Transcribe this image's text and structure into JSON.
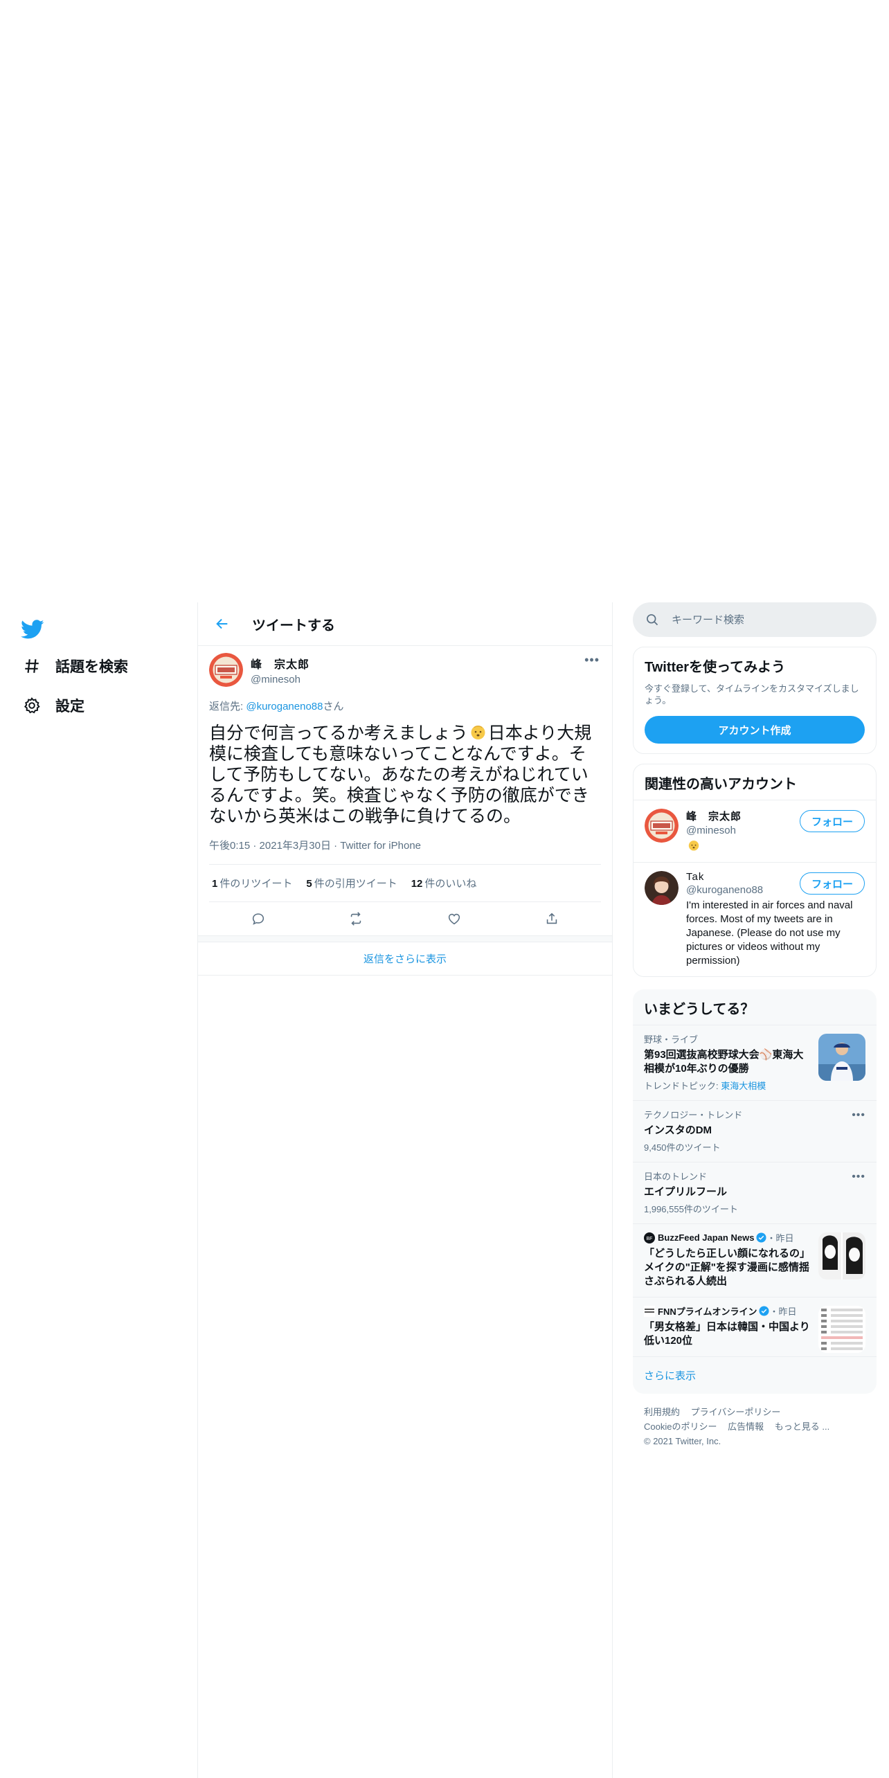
{
  "nav": {
    "explore_label": "話題を検索",
    "settings_label": "設定"
  },
  "header": {
    "title": "ツイートする"
  },
  "tweet": {
    "display_name": "峰　宗太郎",
    "handle": "@minesoh",
    "reply_prefix": "返信先: ",
    "reply_handle": "@kuroganeno88",
    "reply_suffix": "さん",
    "text_part1": "自分で何言ってるか考えましょう",
    "text_part2": "日本より大規模に検査しても意味ないってことなんですよ。そして予防もしてない。あなたの考えがねじれているんですよ。笑。検査じゃなく予防の徹底ができないから英米はこの戦争に負けてるの。",
    "time": "午後0:15",
    "date": "2021年3月30日",
    "client": "Twitter for iPhone",
    "retweets_count": "1",
    "retweets_label": "件のリツイート",
    "quotes_count": "5",
    "quotes_label": "件の引用ツイート",
    "likes_count": "12",
    "likes_label": "件のいいね",
    "show_more_replies": "返信をさらに表示"
  },
  "search": {
    "placeholder": "キーワード検索"
  },
  "signup_card": {
    "title": "Twitterを使ってみよう",
    "subtitle": "今すぐ登録して、タイムラインをカスタマイズしましょう。",
    "button": "アカウント作成"
  },
  "related": {
    "title": "関連性の高いアカウント",
    "follow_label": "フォロー",
    "accounts": [
      {
        "name": "峰　宗太郎",
        "handle": "@minesoh",
        "bio": ""
      },
      {
        "name": "Tak",
        "handle": "@kuroganeno88",
        "bio": "I'm interested in air forces and naval forces. Most of my tweets are in Japanese. (Please do not use my pictures or videos without my permission)"
      }
    ]
  },
  "trends": {
    "title": "いまどうしてる？",
    "items": [
      {
        "category": "野球・ライブ",
        "title": "第93回選抜高校野球大会⚾東海大相模が10年ぶりの優勝",
        "count_prefix": "トレンドトピック: ",
        "count_link": "東海大相模"
      },
      {
        "category": "テクノロジー・トレンド",
        "title": "インスタのDM",
        "count": "9,450件のツイート"
      },
      {
        "category": "日本のトレンド",
        "title": "エイプリルフール",
        "count": "1,996,555件のツイート"
      },
      {
        "source": "BuzzFeed Japan News",
        "time": "・昨日",
        "title": "「どうしたら正しい顔になれるの」メイクの\"正解\"を探す漫画に感情揺さぶられる人続出"
      },
      {
        "source": "FNNプライムオンライン",
        "time": "・昨日",
        "title": "「男女格差」日本は韓国・中国より低い120位"
      }
    ],
    "show_more": "さらに表示"
  },
  "footer": {
    "terms": "利用規約",
    "privacy": "プライバシーポリシー",
    "cookies": "Cookieのポリシー",
    "ads": "広告情報",
    "more": "もっと見る ...",
    "copyright": "© 2021 Twitter, Inc."
  },
  "colors": {
    "brand": "#1da1f2",
    "link": "#1b95e0",
    "secondary_text": "#5b7083"
  }
}
